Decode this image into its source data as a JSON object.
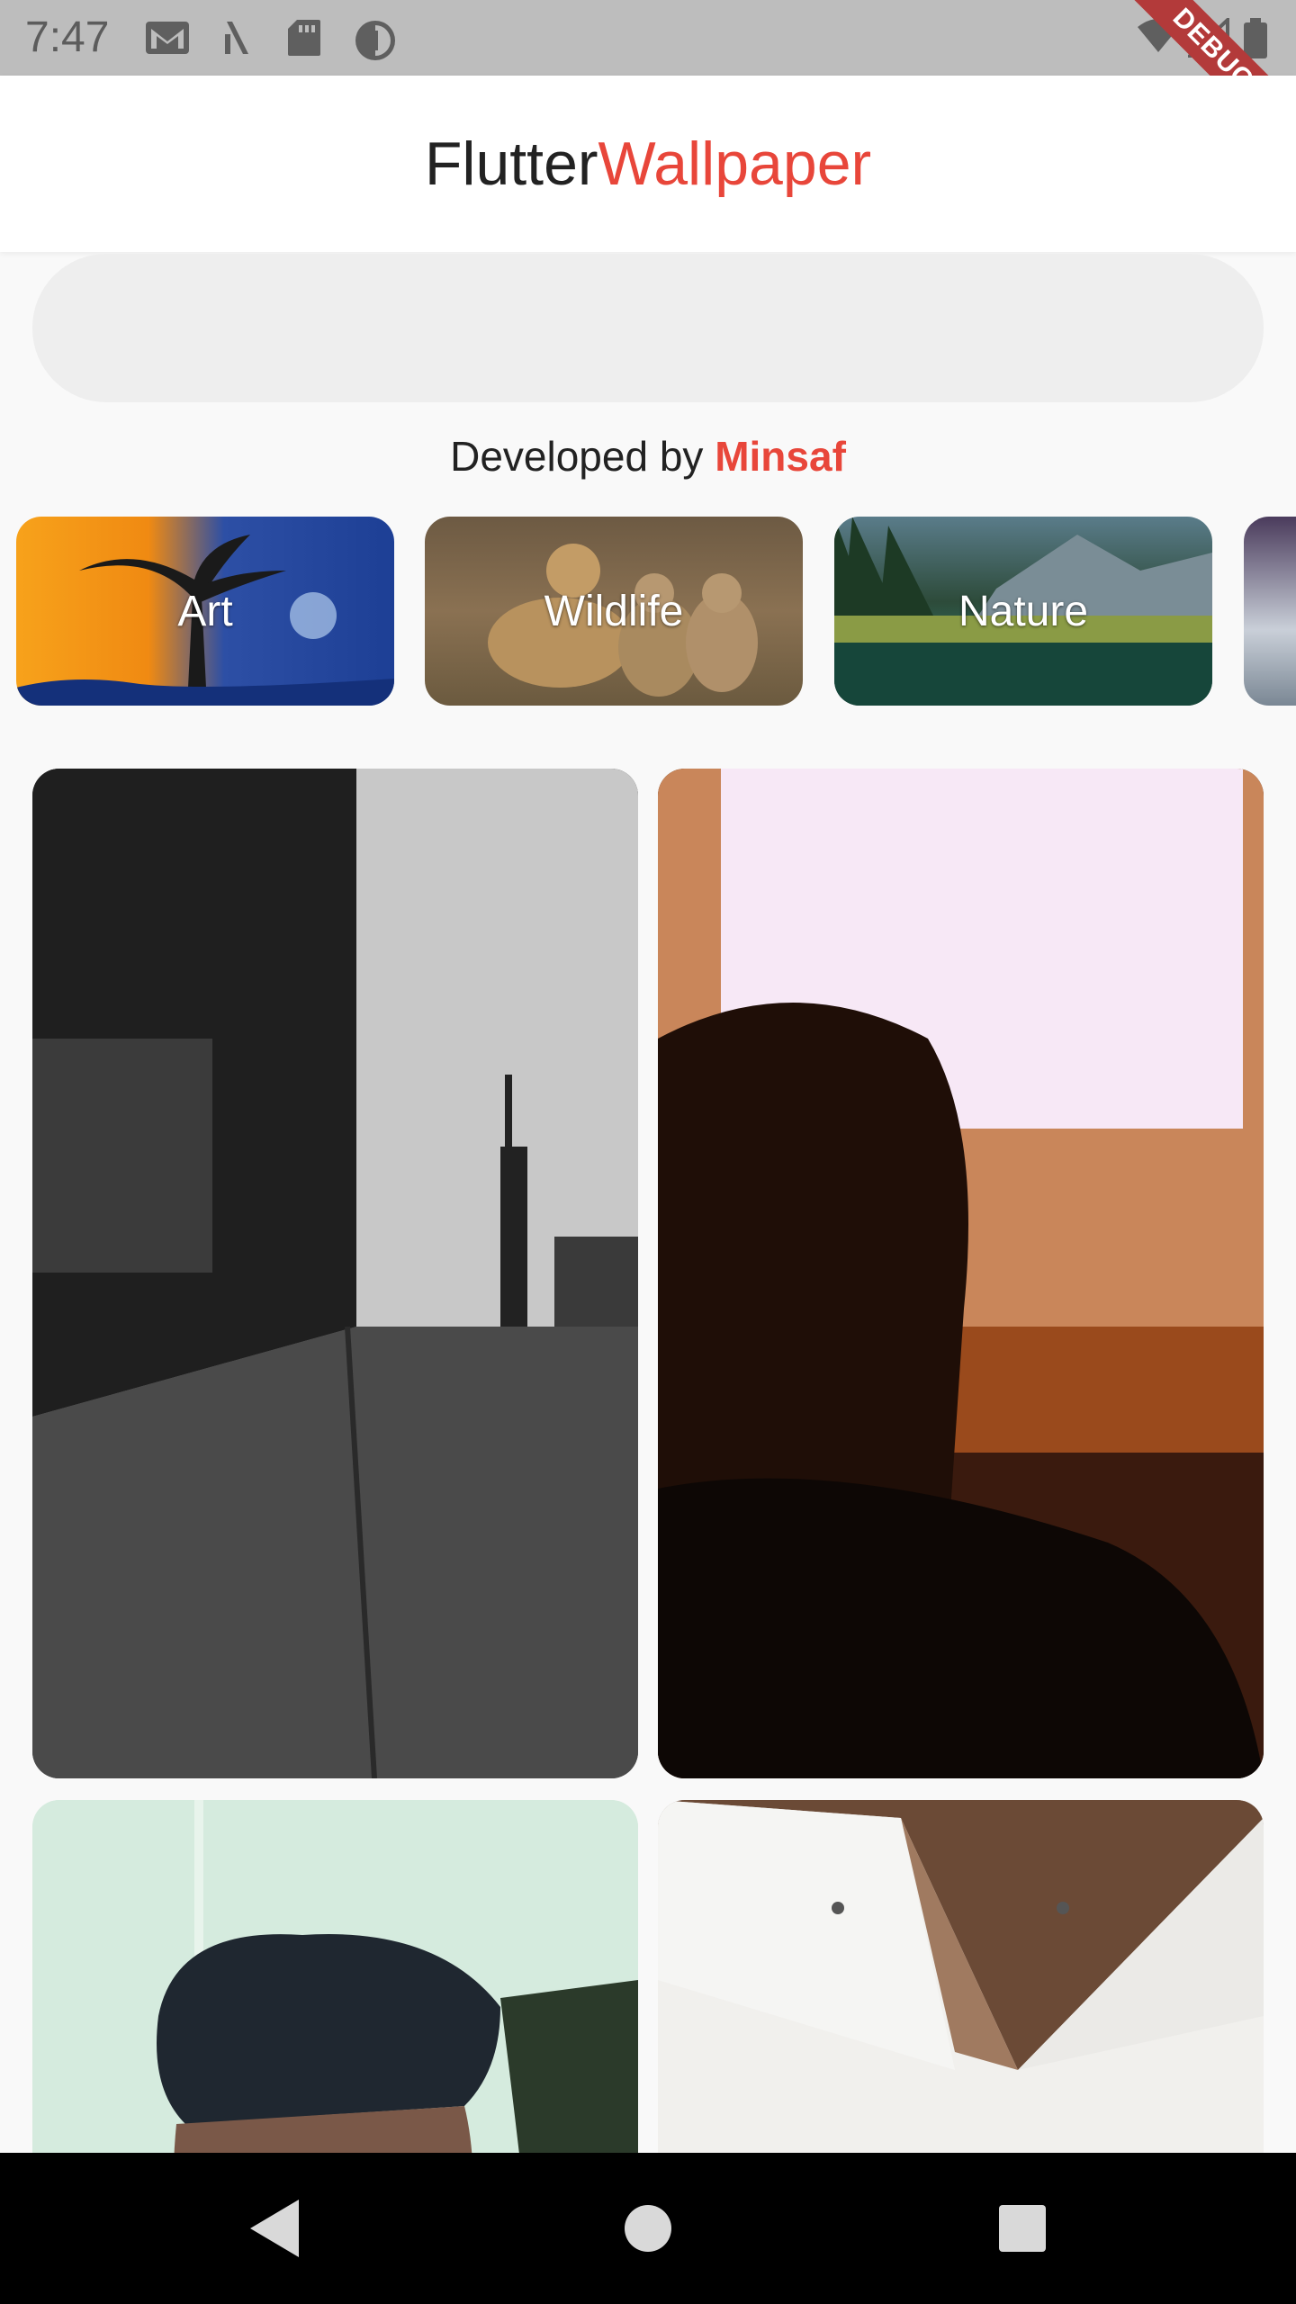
{
  "status_bar": {
    "time": "7:47",
    "left_icons": [
      "gmail-icon",
      "signal-slash-icon",
      "sd-card-icon",
      "data-saver-icon"
    ],
    "right_icons": [
      "wifi-icon",
      "cell-signal-icon",
      "battery-icon"
    ],
    "debug_label": "DEBUG"
  },
  "app_bar": {
    "title_part1": "Flutter",
    "title_part2": "Wallpaper",
    "title_color_1": "#222222",
    "title_color_2": "#e8463a"
  },
  "search": {
    "value": "",
    "placeholder": ""
  },
  "developer": {
    "prefix": "Developed by ",
    "name": "Minsaf"
  },
  "categories": [
    {
      "label": "Art"
    },
    {
      "label": "Wildlife"
    },
    {
      "label": "Nature"
    },
    {
      "label": ""
    }
  ],
  "wallpapers": [
    {
      "subject": "street-photo"
    },
    {
      "subject": "person-silhouette-photo"
    },
    {
      "subject": "portrait-photo"
    },
    {
      "subject": "white-shirt-photo"
    }
  ],
  "nav_bar": {
    "buttons": [
      "back-icon",
      "home-icon",
      "recents-icon"
    ]
  },
  "colors": {
    "accent": "#e8463a",
    "status_bar_bg": "#bdbdbd",
    "nav_bar_bg": "#000000",
    "search_bg": "#eeeeee"
  }
}
